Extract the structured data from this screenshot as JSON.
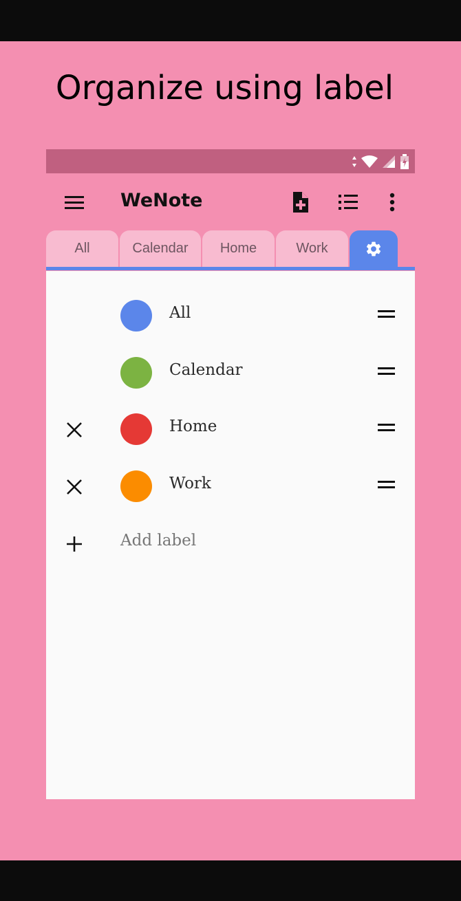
{
  "headline": "Organize using label",
  "app": {
    "title": "WeNote"
  },
  "toolbar_icons": [
    "menu-icon",
    "new-note-icon",
    "list-view-icon",
    "more-vert-icon"
  ],
  "tabs": [
    {
      "label": "All"
    },
    {
      "label": "Calendar"
    },
    {
      "label": "Home"
    },
    {
      "label": "Work"
    },
    {
      "label": "",
      "icon": "gear-icon",
      "active": true
    }
  ],
  "labels": [
    {
      "name": "All",
      "color": "#5b86ea",
      "deletable": false
    },
    {
      "name": "Calendar",
      "color": "#7cb342",
      "deletable": false
    },
    {
      "name": "Home",
      "color": "#e53935",
      "deletable": true
    },
    {
      "name": "Work",
      "color": "#fb8c00",
      "deletable": true
    }
  ],
  "add_label": "Add label",
  "colors": {
    "background": "#f48fb1",
    "status_bar": "#c06080",
    "tab": "#f8bbd0",
    "accent": "#5b86ea",
    "content": "#fafafa"
  }
}
